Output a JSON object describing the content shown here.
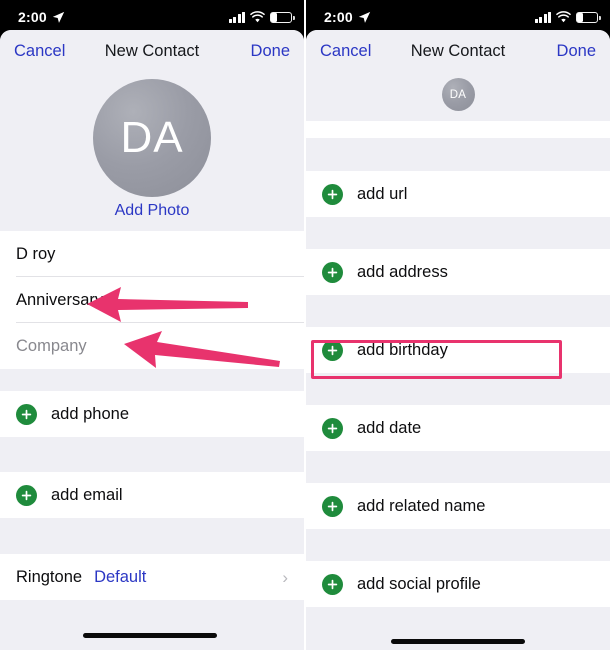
{
  "status_bar": {
    "time": "2:00",
    "location_icon": "location-arrow-icon",
    "signal_icon": "cellular-signal-icon",
    "wifi_icon": "wifi-icon",
    "battery_icon": "battery-low-icon"
  },
  "left_panel": {
    "nav": {
      "cancel_label": "Cancel",
      "title": "New Contact",
      "done_label": "Done"
    },
    "avatar": {
      "initials": "DA",
      "add_photo_label": "Add Photo"
    },
    "name_fields": [
      {
        "value": "D roy",
        "is_placeholder": false
      },
      {
        "value": "Anniversary",
        "is_placeholder": false
      },
      {
        "value": "Company",
        "is_placeholder": true
      }
    ],
    "actions": [
      {
        "label": "add phone"
      },
      {
        "label": "add email"
      }
    ],
    "ringtone": {
      "label": "Ringtone",
      "value": "Default",
      "chevron": "›"
    }
  },
  "right_panel": {
    "nav": {
      "cancel_label": "Cancel",
      "title": "New Contact",
      "done_label": "Done"
    },
    "avatar": {
      "initials": "DA"
    },
    "actions": [
      {
        "label": "add url",
        "highlighted": false
      },
      {
        "label": "add address",
        "highlighted": false
      },
      {
        "label": "add birthday",
        "highlighted": true
      },
      {
        "label": "add date",
        "highlighted": false
      },
      {
        "label": "add related name",
        "highlighted": false
      },
      {
        "label": "add social profile",
        "highlighted": false
      }
    ]
  },
  "annotations": {
    "arrow_color": "#e8336d",
    "highlight_color": "#e8336d",
    "arrow_1_target": "D roy",
    "arrow_2_target": "Anniversary",
    "highlight_target": "add birthday"
  },
  "colors": {
    "accent_blue": "#2b37c4",
    "plus_green": "#1f8b3c",
    "sheet_bg": "#efeff4",
    "row_bg": "#ffffff",
    "placeholder_gray": "#88888e"
  }
}
